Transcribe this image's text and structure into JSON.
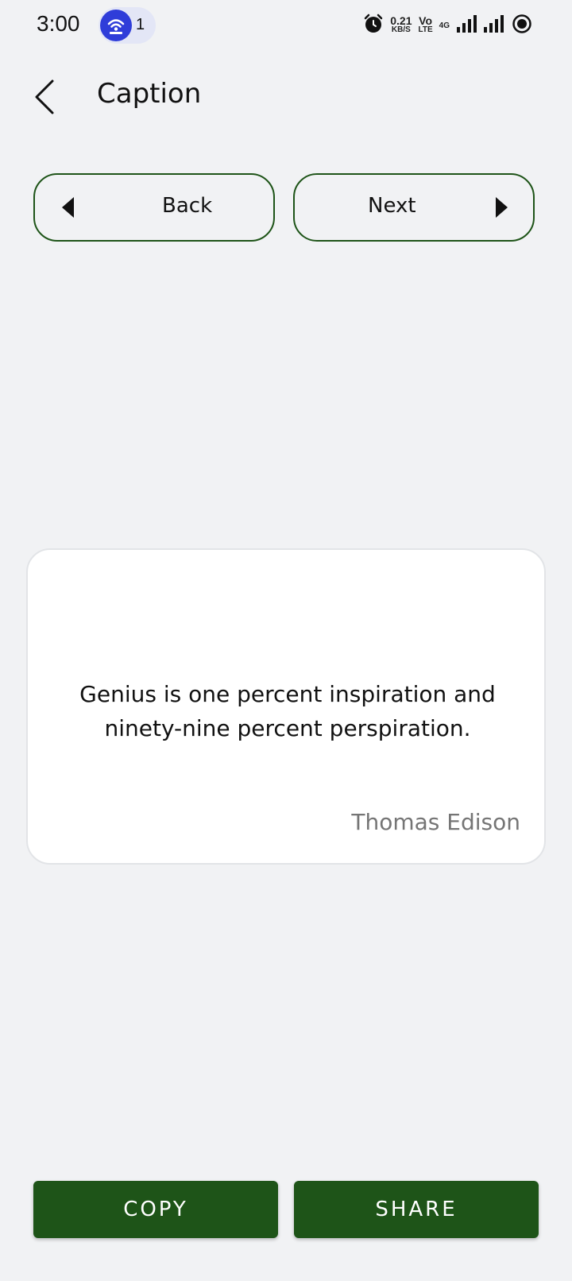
{
  "status_bar": {
    "time": "3:00",
    "hotspot_count": "1",
    "net_speed_value": "0.21",
    "net_speed_unit": "KB/S",
    "volte_top": "Vo",
    "volte_bottom": "LTE",
    "network_type": "4G",
    "icons": [
      "hotspot-icon",
      "alarm-icon",
      "signal-icon",
      "signal-icon",
      "battery-icon"
    ]
  },
  "header": {
    "title": "Caption",
    "back_icon": "chevron-left-icon"
  },
  "nav": {
    "back_label": "Back",
    "next_label": "Next"
  },
  "quote": {
    "text": "Genius is one percent inspiration and ninety-nine percent perspiration.",
    "author": "Thomas Edison"
  },
  "actions": {
    "copy_label": "COPY",
    "share_label": "SHARE"
  },
  "colors": {
    "accent": "#1e5418",
    "background": "#f1f2f4",
    "card": "#ffffff",
    "author_text": "#757575",
    "hotspot": "#2f3dd9"
  }
}
